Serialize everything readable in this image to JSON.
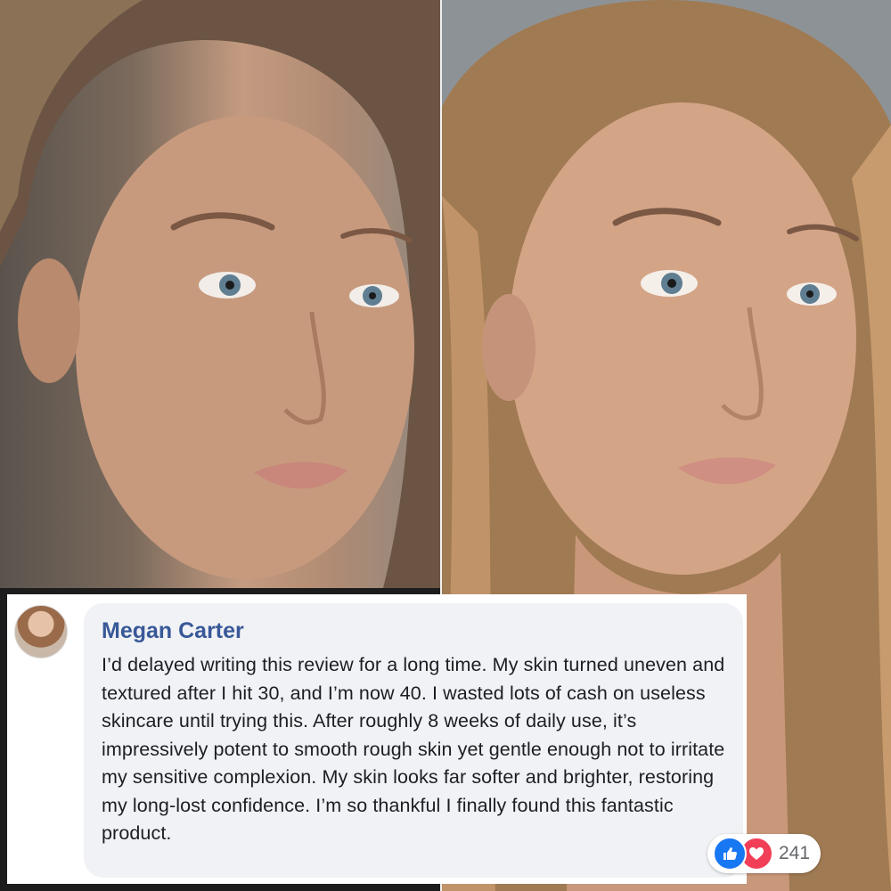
{
  "comment": {
    "author": "Megan Carter",
    "text": "I’d delayed writing this review for a long time. My skin turned uneven and textured after I hit 30, and I’m now 40. I wasted lots of cash on useless skincare until trying this. After roughly 8 weeks of daily use, it’s impressively potent to smooth rough skin yet gentle enough not to irritate my sensitive complexion. My skin looks far softer and brighter, restoring my long-lost confidence. I’m so thankful I finally found this fantastic product.",
    "reaction_count": "241",
    "reactions": [
      "like-icon",
      "love-icon"
    ]
  },
  "colors": {
    "author_name": "#385898",
    "bubble_bg": "#f0f2f5",
    "like": "#1877f2",
    "love": "#f33e58"
  }
}
